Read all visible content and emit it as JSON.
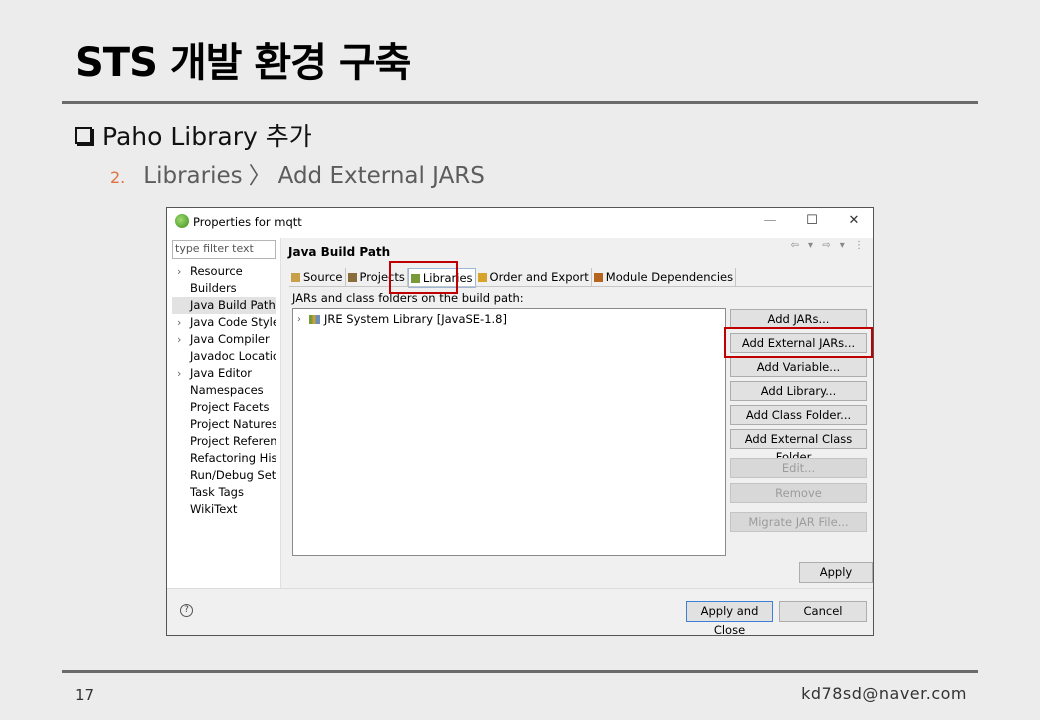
{
  "slide": {
    "title": "STS 개발 환경 구축",
    "bullet": "Paho Library 추가",
    "step_number": "2.",
    "step_part1": "Libraries",
    "step_chevron": "〉",
    "step_part2": "Add External JARS",
    "page_number": "17",
    "email": "kd78sd@naver.com"
  },
  "dialog": {
    "title": "Properties for mqtt",
    "minimize": "—",
    "maximize": "☐",
    "close": "✕",
    "filter_placeholder": "type filter text",
    "tree": [
      {
        "label": "Resource",
        "expandable": true
      },
      {
        "label": "Builders",
        "expandable": false
      },
      {
        "label": "Java Build Path",
        "expandable": false,
        "selected": true
      },
      {
        "label": "Java Code Style",
        "expandable": true
      },
      {
        "label": "Java Compiler",
        "expandable": true
      },
      {
        "label": "Javadoc Location",
        "expandable": false
      },
      {
        "label": "Java Editor",
        "expandable": true
      },
      {
        "label": "Namespaces",
        "expandable": false
      },
      {
        "label": "Project Facets",
        "expandable": false
      },
      {
        "label": "Project Natures",
        "expandable": false
      },
      {
        "label": "Project References",
        "expandable": false
      },
      {
        "label": "Refactoring History",
        "expandable": false
      },
      {
        "label": "Run/Debug Settings",
        "expandable": false
      },
      {
        "label": "Task Tags",
        "expandable": false
      },
      {
        "label": "WikiText",
        "expandable": false
      }
    ],
    "scroll_left": "<",
    "scroll_right": ">",
    "page_title": "Java Build Path",
    "nav_arrows": "⇦ ▾ ⇨ ▾ ⋮",
    "tabs": [
      {
        "label": "Source",
        "icon": "source-folder-icon",
        "color": "#c9a04a"
      },
      {
        "label": "Projects",
        "icon": "projects-icon",
        "color": "#8a6d3b"
      },
      {
        "label": "Libraries",
        "icon": "libraries-icon",
        "color": "#7a9a3a",
        "active": true
      },
      {
        "label": "Order and Export",
        "icon": "order-export-icon",
        "color": "#d6a42a"
      },
      {
        "label": "Module Dependencies",
        "icon": "module-dependencies-icon",
        "color": "#b5651d"
      }
    ],
    "subheading": "JARs and class folders on the build path:",
    "list_items": [
      {
        "label": "JRE System Library [JavaSE-1.8]",
        "expand": "›"
      }
    ],
    "buttons": [
      {
        "label": "Add JARs...",
        "enabled": true
      },
      {
        "label": "Add External JARs...",
        "enabled": true,
        "highlighted": true
      },
      {
        "label": "Add Variable...",
        "enabled": true
      },
      {
        "label": "Add Library...",
        "enabled": true
      },
      {
        "label": "Add Class Folder...",
        "enabled": true
      },
      {
        "label": "Add External Class Folder...",
        "enabled": true
      },
      {
        "label": "Edit...",
        "enabled": false
      },
      {
        "label": "Remove",
        "enabled": false
      },
      {
        "label": "Migrate JAR File...",
        "enabled": false
      }
    ],
    "apply": "Apply",
    "help": "?",
    "apply_and_close": "Apply and Close",
    "cancel": "Cancel"
  },
  "colors": {
    "highlight_box": "#c00000",
    "step_number": "#e0703e"
  }
}
